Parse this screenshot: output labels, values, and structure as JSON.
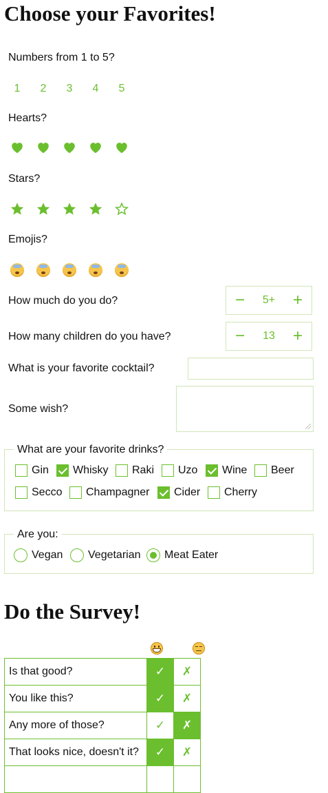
{
  "titles": {
    "favorites": "Choose your Favorites!",
    "survey": "Do the Survey!"
  },
  "numbers": {
    "label": "Numbers from 1 to 5?",
    "items": [
      "1",
      "2",
      "3",
      "4",
      "5"
    ]
  },
  "hearts": {
    "label": "Hearts?",
    "icon": "heart-icon",
    "count": 5,
    "value": 5
  },
  "stars": {
    "label": "Stars?",
    "icon": "star-icon",
    "count": 5,
    "value": 4
  },
  "emojis": {
    "label": "Emojis?",
    "icon": "sleeping-face-icon",
    "count": 5
  },
  "how_much": {
    "label": "How much do you do?",
    "value": "5+",
    "minus": "−",
    "plus": "+"
  },
  "children": {
    "label": "How many children do you have?",
    "value": "13",
    "minus": "−",
    "plus": "+"
  },
  "cocktail": {
    "label": "What is your favorite cocktail?",
    "value": ""
  },
  "wish": {
    "label": "Some wish?",
    "value": ""
  },
  "drinks": {
    "legend": "What are your favorite drinks?",
    "options": [
      {
        "label": "Gin",
        "checked": false
      },
      {
        "label": "Whisky",
        "checked": true
      },
      {
        "label": "Raki",
        "checked": false
      },
      {
        "label": "Uzo",
        "checked": false
      },
      {
        "label": "Wine",
        "checked": true
      },
      {
        "label": "Beer",
        "checked": false
      },
      {
        "label": "Secco",
        "checked": false
      },
      {
        "label": "Champagner",
        "checked": false
      },
      {
        "label": "Cider",
        "checked": true
      },
      {
        "label": "Cherry",
        "checked": false
      }
    ]
  },
  "diet": {
    "legend": "Are you:",
    "options": [
      {
        "label": "Vegan",
        "selected": false
      },
      {
        "label": "Vegetarian",
        "selected": false
      },
      {
        "label": "Meat Eater",
        "selected": true
      }
    ]
  },
  "survey": {
    "columns": [
      "grinning-face-icon",
      "unamused-face-icon"
    ],
    "check": "✓",
    "cross": "✗",
    "rows": [
      {
        "question": "Is that good?",
        "answer": "good"
      },
      {
        "question": "You like this?",
        "answer": "good"
      },
      {
        "question": "Any more of those?",
        "answer": "bad"
      },
      {
        "question": "That looks nice, doesn't it?",
        "answer": "good"
      }
    ]
  },
  "colors": {
    "accent": "#6bbf2e",
    "border": "#cfe6b8"
  }
}
